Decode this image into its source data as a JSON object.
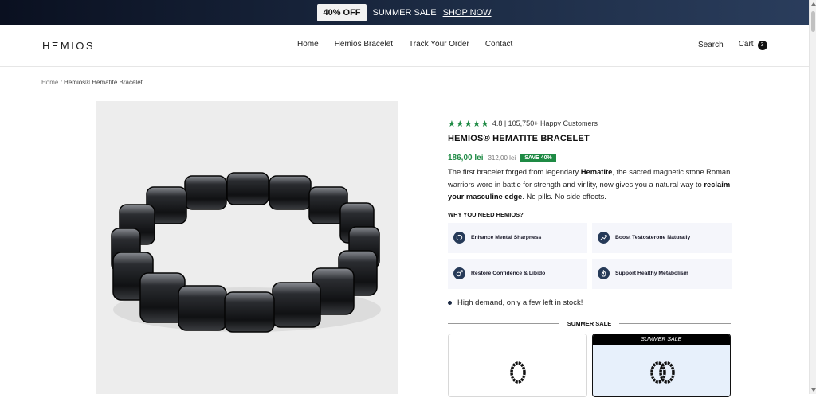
{
  "promo": {
    "badge": "40% OFF",
    "text": "SUMMER SALE",
    "link": "SHOP NOW"
  },
  "header": {
    "logo": "HΞMIOS",
    "nav": [
      "Home",
      "Hemios Bracelet",
      "Track Your Order",
      "Contact"
    ],
    "search": "Search",
    "cart": "Cart",
    "cart_count": "3"
  },
  "breadcrumb": {
    "home": "Home",
    "sep": "/",
    "current": "Hemios® Hematite Bracelet"
  },
  "product": {
    "stars": "★★★★★",
    "rating": "4.8 | 105,750+ Happy Customers",
    "title": "HEMIOS® HEMATITE BRACELET",
    "price": "186,00 lei",
    "old_price": "312,00 lei",
    "save": "SAVE 40%",
    "desc": {
      "p1": "The first bracelet forged from legendary ",
      "b1": "Hematite",
      "p2": ", the sacred magnetic stone Roman warriors wore in battle for strength and virility, now gives you a natural way to ",
      "b2": "reclaim your masculine edge",
      "p3": ". No pills. No side effects."
    },
    "why_title": "WHY YOU NEED HEMIOS?",
    "benefits": [
      {
        "icon": "brain-icon",
        "label": "Enhance Mental Sharpness"
      },
      {
        "icon": "trend-up-icon",
        "label": "Boost Testosterone Naturally"
      },
      {
        "icon": "male-symbol-icon",
        "label": "Restore Confidence & Libido"
      },
      {
        "icon": "flame-icon",
        "label": "Support Healthy Metabolism"
      }
    ],
    "stock": "High demand, only a few left in stock!",
    "sale_divider": "SUMMER SALE",
    "offers": [
      {
        "tag": ""
      },
      {
        "tag": "SUMMER SALE"
      }
    ]
  },
  "colors": {
    "accent": "#1e8a44",
    "navy": "#263a58"
  }
}
